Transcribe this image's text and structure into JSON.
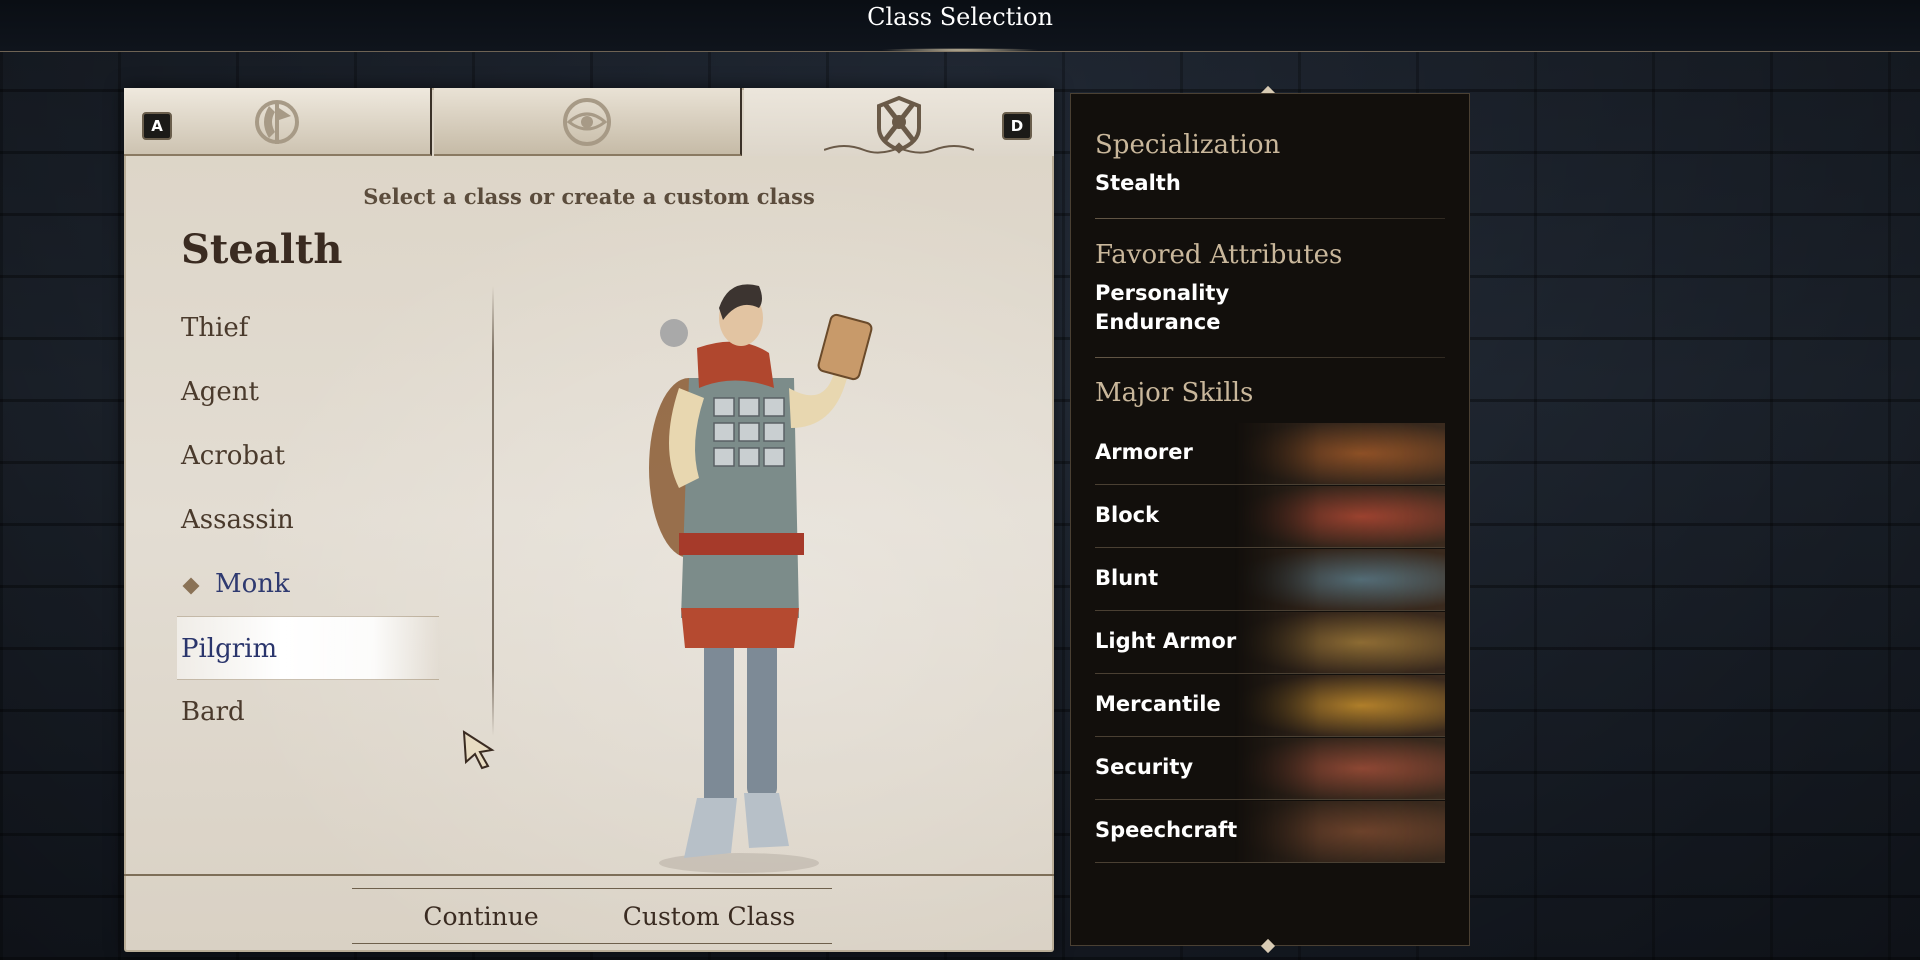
{
  "header": {
    "title": "Class Selection"
  },
  "tabs": [
    {
      "icon": "axe-emblem-icon",
      "key": "A"
    },
    {
      "icon": "eye-emblem-icon"
    },
    {
      "icon": "crossed-daggers-emblem-icon",
      "key": "D",
      "active": true
    }
  ],
  "panel": {
    "subtitle": "Select a class or create a custom class",
    "specialization_heading": "Stealth",
    "classes": [
      {
        "label": "Thief"
      },
      {
        "label": "Agent"
      },
      {
        "label": "Acrobat"
      },
      {
        "label": "Assassin"
      },
      {
        "label": "Monk",
        "state": "selected"
      },
      {
        "label": "Pilgrim",
        "state": "hovered"
      },
      {
        "label": "Bard"
      }
    ],
    "buttons": {
      "continue": "Continue",
      "custom_class": "Custom Class"
    }
  },
  "info": {
    "specialization_label": "Specialization",
    "specialization_value": "Stealth",
    "attributes_label": "Favored Attributes",
    "attributes": [
      "Personality",
      "Endurance"
    ],
    "skills_label": "Major Skills",
    "skills": [
      {
        "name": "Armorer",
        "art_color": "#a05a2a"
      },
      {
        "name": "Block",
        "art_color": "#b04a35"
      },
      {
        "name": "Blunt",
        "art_color": "#5d7a86"
      },
      {
        "name": "Light Armor",
        "art_color": "#a07a3a"
      },
      {
        "name": "Mercantile",
        "art_color": "#c8902f"
      },
      {
        "name": "Security",
        "art_color": "#a0503a"
      },
      {
        "name": "Speechcraft",
        "art_color": "#7a4a30"
      }
    ]
  }
}
